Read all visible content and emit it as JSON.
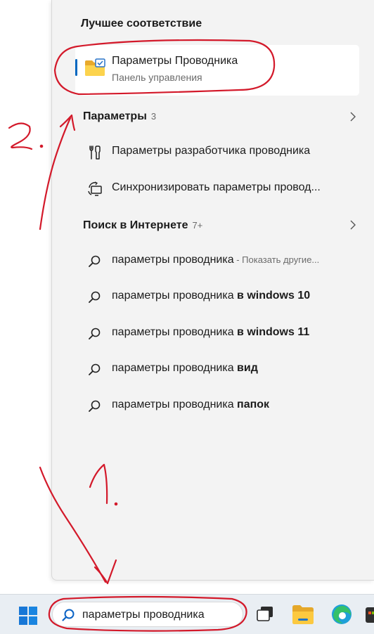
{
  "best_match": {
    "heading": "Лучшее соответствие",
    "title": "Параметры Проводника",
    "subtitle": "Панель управления",
    "icon": "folder-icon"
  },
  "settings": {
    "heading": "Параметры",
    "count": "3",
    "items": [
      {
        "label": "Параметры разработчика проводника",
        "icon": "developer-tools-icon"
      },
      {
        "label": "Синхронизировать параметры провод...",
        "icon": "sync-settings-icon"
      }
    ]
  },
  "web": {
    "heading": "Поиск в Интернете",
    "count": "7+",
    "items": [
      {
        "query": "параметры проводника",
        "suffix": "",
        "hint": " - Показать другие..."
      },
      {
        "query": "параметры проводника ",
        "suffix": "в windows 10",
        "hint": ""
      },
      {
        "query": "параметры проводника ",
        "suffix": "в windows 11",
        "hint": ""
      },
      {
        "query": "параметры проводника ",
        "suffix": "вид",
        "hint": ""
      },
      {
        "query": "параметры проводника ",
        "suffix": "папок",
        "hint": ""
      }
    ]
  },
  "taskbar": {
    "search_value": "параметры проводника",
    "apps": [
      "start-icon",
      "task-view-icon",
      "file-explorer-icon",
      "edge-icon",
      "store-icon"
    ]
  },
  "annotations": {
    "label_1": "1.",
    "label_2": "2."
  },
  "colors": {
    "accent": "#0067c0",
    "annotation": "#d3192a",
    "panel_bg": "#f3f3f3",
    "taskbar_bg": "#e9eef3"
  }
}
